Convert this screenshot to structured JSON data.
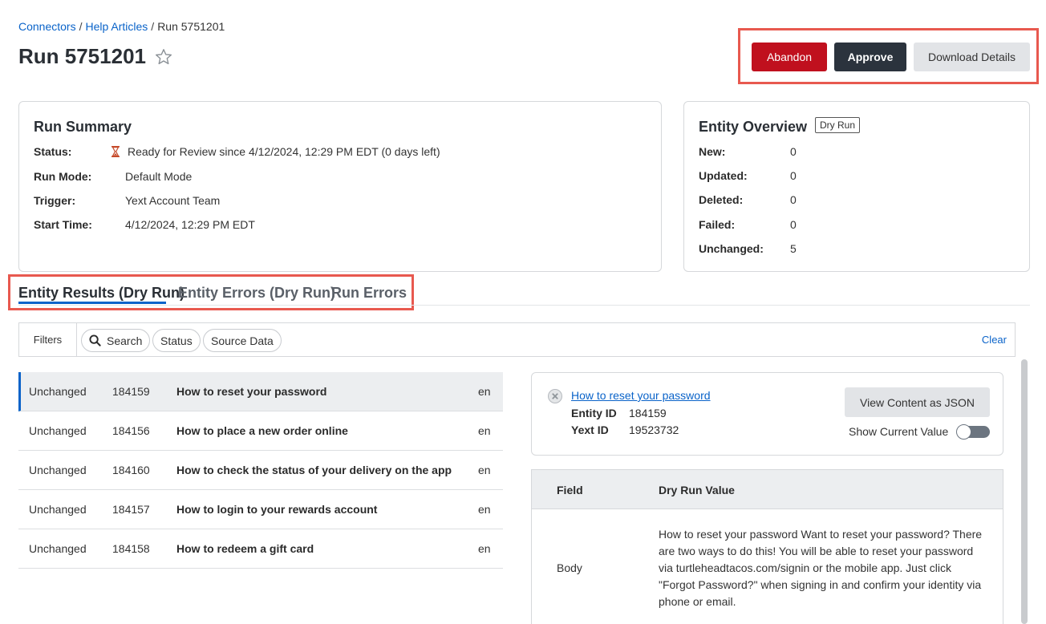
{
  "breadcrumb": {
    "item1": "Connectors",
    "item2": "Help Articles",
    "item3": "Run 5751201",
    "separator": "/"
  },
  "header": {
    "title": "Run 5751201",
    "star_icon": "star-outline-icon"
  },
  "actions": {
    "abandon": "Abandon",
    "approve": "Approve",
    "download": "Download Details",
    "abandon_color": "#c0101e",
    "approve_color": "#2b333d"
  },
  "summary": {
    "title": "Run Summary",
    "status_label": "Status:",
    "status_value": "Ready for Review since 4/12/2024, 12:29 PM EDT (0 days left)",
    "status_icon": "hourglass-icon",
    "mode_label": "Run Mode:",
    "mode_value": "Default Mode",
    "trigger_label": "Trigger:",
    "trigger_value": "Yext Account Team",
    "start_label": "Start Time:",
    "start_value": "4/12/2024, 12:29 PM EDT"
  },
  "overview": {
    "title": "Entity Overview",
    "badge": "Dry Run",
    "new_label": "New:",
    "new_value": "0",
    "updated_label": "Updated:",
    "updated_value": "0",
    "deleted_label": "Deleted:",
    "deleted_value": "0",
    "failed_label": "Failed:",
    "failed_value": "0",
    "unchanged_label": "Unchanged:",
    "unchanged_value": "5"
  },
  "tabs": {
    "t1": "Entity Results (Dry Run)",
    "t2": "Entity Errors (Dry Run)",
    "t3": "Run Errors"
  },
  "filters": {
    "label": "Filters",
    "search": "Search",
    "status": "Status",
    "source": "Source Data",
    "clear": "Clear"
  },
  "results": [
    {
      "status": "Unchanged",
      "id": "184159",
      "title": "How to reset your password",
      "lang": "en"
    },
    {
      "status": "Unchanged",
      "id": "184156",
      "title": "How to place a new order online",
      "lang": "en"
    },
    {
      "status": "Unchanged",
      "id": "184160",
      "title": "How to check the status of your delivery on the app",
      "lang": "en"
    },
    {
      "status": "Unchanged",
      "id": "184157",
      "title": "How to login to your rewards account",
      "lang": "en"
    },
    {
      "status": "Unchanged",
      "id": "184158",
      "title": "How to redeem a gift card",
      "lang": "en"
    }
  ],
  "detail": {
    "title_link": "How to reset your password",
    "entity_id_label": "Entity ID",
    "entity_id_value": "184159",
    "yext_id_label": "Yext ID",
    "yext_id_value": "19523732",
    "json_button": "View Content as JSON",
    "show_current": "Show Current Value"
  },
  "field_table": {
    "col_field": "Field",
    "col_value": "Dry Run Value",
    "row_field": "Body",
    "row_value": "How to reset your password Want to reset your password? There are two ways to do this! You will be able to reset your password via turtleheadtacos.com/signin or the mobile app. Just click \"Forgot Password?\" when signing in and confirm your identity via phone or email."
  }
}
